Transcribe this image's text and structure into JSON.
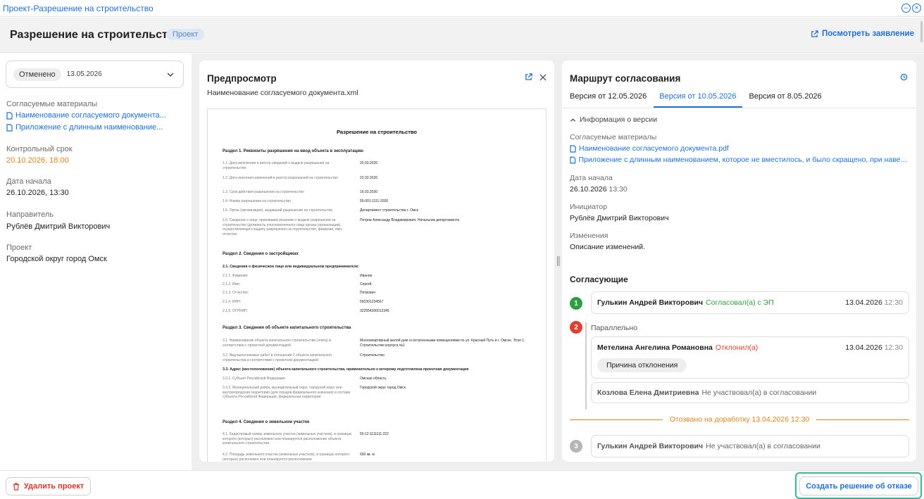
{
  "window": {
    "title": "Проект-Разрешение на строительство"
  },
  "header": {
    "title": "Разрешение на строительство",
    "badge": "Проект",
    "view_link": "Посмотреть заявление"
  },
  "left": {
    "status": "Отменено",
    "status_date": "13.05.2026",
    "materials_label": "Согласуемые материалы",
    "materials": [
      "Наименование согласуемого документа...",
      "Приложение с длинным наименование..."
    ],
    "deadline_label": "Контрольный срок",
    "deadline_value": "20.10.2026, 18:00",
    "start_label": "Дата начала",
    "start_value": "26.10.2026, 13:30",
    "sender_label": "Направитель",
    "sender_value": "Рублёв Дмитрий Викторович",
    "project_label": "Проект",
    "project_value": "Городской округ город Омск"
  },
  "preview": {
    "title": "Предпросмотр",
    "file_name": "Наименование согласуемого документа.xml",
    "doc": {
      "title": "Разрешение на строительство",
      "section1": "Раздел 1. Реквизиты разрешения на ввод объекта в эксплуатацию",
      "s1_rows": [
        {
          "k": "1.1. Дата включения в реестр сведений о выдаче разрешения на строительство",
          "v": "20.03.2026"
        },
        {
          "k": "1.2. Дата внесения изменений в реестр разрешений на строительство",
          "v": "22.03.2026"
        },
        {
          "k": "1.3. Срок действия разрешения на строительство",
          "v": "16.03.2030"
        },
        {
          "k": "1.4. Номер разрешения на строительство",
          "v": "55-001-1111-2026"
        },
        {
          "k": "1.5. Орган (организация), выдавший разрешение на строительство",
          "v": "Департамент строительства г. Омск"
        },
        {
          "k": "1.6. Сведения о лице, принявшем решение о выдаче разрешения на строительство (должность уполномоченного лица органа (организации), осуществляющего выдачу разрешения на строительство, фамилия, имя, отчество",
          "v": "Петров Александр Владимирович, Начальник департамента"
        }
      ],
      "section2": "Раздел 2. Сведения о застройщиках",
      "s2_sub": "2.1. Сведения о физическом лице или индивидуальном предпринимателе:",
      "s2_rows": [
        {
          "k": "2.1.1. Фамилия:",
          "v": "Иванов"
        },
        {
          "k": "2.1.2. Имя:",
          "v": "Сергей"
        },
        {
          "k": "2.1.3. Отчество:",
          "v": "Петрович"
        },
        {
          "k": "2.1.4. ИНН:",
          "v": "550301234567"
        },
        {
          "k": "2.1.5. ОГРНИП:",
          "v": "322554300012345"
        }
      ],
      "section3": "Раздел 3. Сведения об объекте капитального строительства",
      "s3_rows": [
        {
          "k": "3.1. Наименование объекта капитального строительства (этапа) в соответствии с проектной документацией",
          "v": "Многоквартирный жилой дом со встроенными помещениями по ул. Красный Путь в г. Омске, Этап 1. Строительство корпуса №1"
        },
        {
          "k": "3.2. Вид выполняемых работ в отношении 2 объекта капитального строительства в соответствии с проектной документацией",
          "v": "Строительство"
        }
      ],
      "s3_sub": "3.3. Адрес (местоположение) объекта капитального строительства, применительно к которому подготовлена проектная документация",
      "s3_rows2": [
        {
          "k": "3.3.1. Субъект Российской Федерации",
          "v": "Омская область"
        },
        {
          "k": "3.3.2. Муниципальный район, муниципальный округ, городской округ или внутригородская территория (для городов федерального значения) в составе субъекта Российской Федерации, федеральная территория:",
          "v": "Городской округ город Омск"
        }
      ],
      "section4": "Раздел 4. Сведения о земельном участке",
      "s4_rows": [
        {
          "k": "4.1. Кадастровый номер земельного участка (земельных участков), в границах которого (которых) расположен или планируется расположение объекта капитального строительства",
          "v": "55:12:1111111:222"
        },
        {
          "k": "4.2. Площадь земельного участка (земельных участков), в границах которого (которых) расположен или планируется расположение",
          "v": "600 кв. м"
        }
      ]
    }
  },
  "route": {
    "title": "Маршрут согласования",
    "tabs": [
      "Версия от 12.05.2026",
      "Версия от 10.05.2026",
      "Версия от 8.05.2026"
    ],
    "active_tab": 1,
    "version_info": "Информация о версии",
    "materials_label": "Согласуемые материалы",
    "materials": [
      "Наименование согласуемого документа.pdf",
      "Приложение с длинным наименованием, которое не вместилось, и было скращено, при наведении..."
    ],
    "start_label": "Дата начала",
    "start_date": "26.10.2026",
    "start_time": "13:30",
    "initiator_label": "Инициатор",
    "initiator_value": "Рублёв Дмитрий Викторович",
    "changes_label": "Изменения",
    "changes_value": "Описание изменений.",
    "approvers_title": "Согласующие",
    "steps": [
      {
        "num": "1",
        "name": "Гулькин Андрей Викторович",
        "status": "Согласовал(а) с ЭП",
        "date": "13.04.2026",
        "time": "12:30"
      },
      {
        "num": "2",
        "parallel_label": "Параллельно",
        "name": "Метелина Ангелина Романовна",
        "status": "Отклонил(а)",
        "date": "13.04.2026",
        "time": "12:30",
        "reason": "Причина отклонения",
        "name2": "Козлова Елена Дмитриевна",
        "status2": "Не участвовал(а) в согласовании"
      },
      {
        "num": "3",
        "name": "Гулькин Андрей Викторович",
        "status": "Не участвовал(а) в согласовании"
      }
    ],
    "revoked": "Отозвано на доработку 13.04.2026 12:30"
  },
  "footer": {
    "delete": "Удалить проект",
    "refuse": "Создать решение об отказе"
  },
  "colors": {
    "accent": "#1f6fd6",
    "success": "#2e9e45",
    "danger": "#e0402f",
    "warning": "#e0821b",
    "highlight": "#3ab494"
  }
}
